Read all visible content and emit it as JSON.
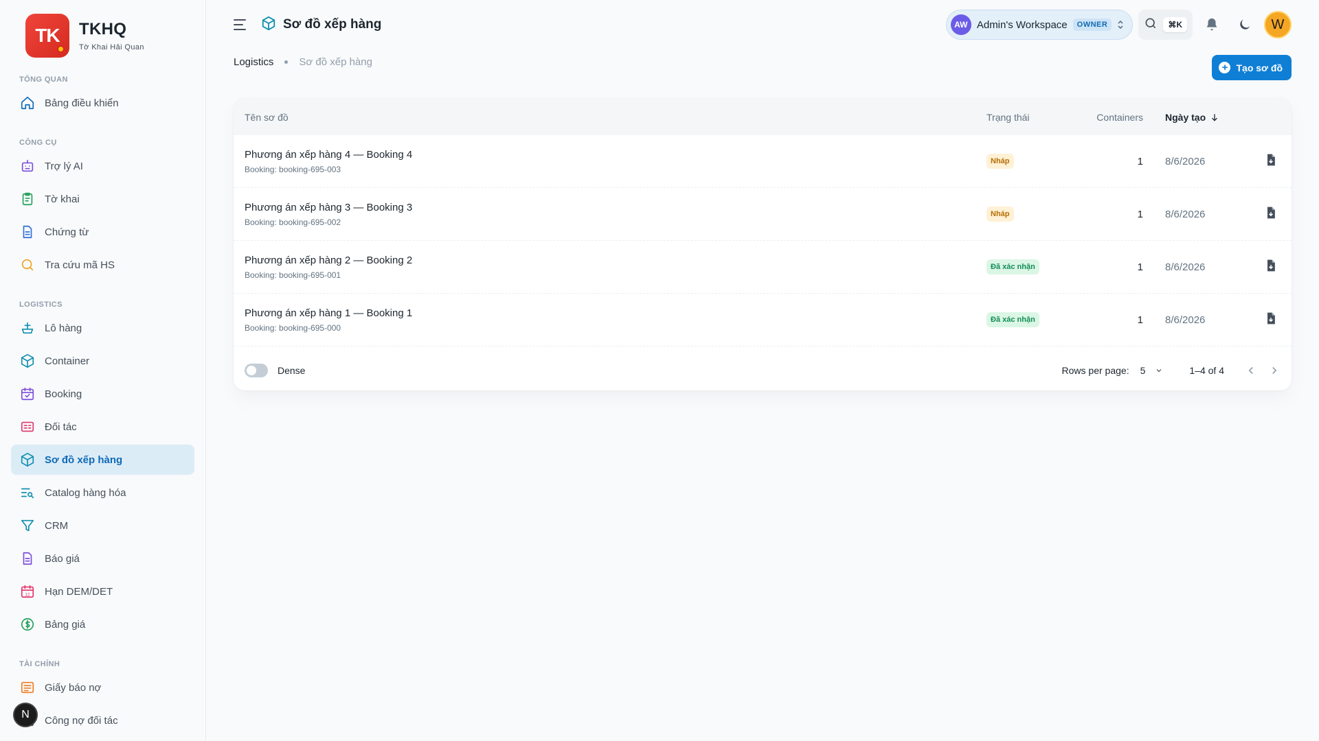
{
  "brand": {
    "logo": "TK",
    "name": "TKHQ",
    "subtitle": "Tờ Khai Hải Quan"
  },
  "sidebar": {
    "sections": [
      {
        "title": "TỔNG QUAN",
        "items": [
          {
            "label": "Bảng điều khiển",
            "icon": "home-icon"
          }
        ]
      },
      {
        "title": "CÔNG CỤ",
        "items": [
          {
            "label": "Trợ lý AI",
            "icon": "robot-icon"
          },
          {
            "label": "Tờ khai",
            "icon": "clipboard-icon"
          },
          {
            "label": "Chứng từ",
            "icon": "document-icon"
          },
          {
            "label": "Tra cứu mã HS",
            "icon": "search-icon"
          }
        ]
      },
      {
        "title": "LOGISTICS",
        "items": [
          {
            "label": "Lô hàng",
            "icon": "ship-icon"
          },
          {
            "label": "Container",
            "icon": "box-icon"
          },
          {
            "label": "Booking",
            "icon": "calendar-check-icon"
          },
          {
            "label": "Đối tác",
            "icon": "id-card-icon"
          },
          {
            "label": "Sơ đồ xếp hàng",
            "icon": "cube-icon",
            "active": true
          },
          {
            "label": "Catalog hàng hóa",
            "icon": "list-search-icon"
          },
          {
            "label": "CRM",
            "icon": "filter-icon"
          },
          {
            "label": "Báo giá",
            "icon": "file-text-icon"
          },
          {
            "label": "Hạn DEM/DET",
            "icon": "calendar-12-icon"
          },
          {
            "label": "Bảng giá",
            "icon": "dollar-circle-icon"
          }
        ]
      },
      {
        "title": "TÀI CHÍNH",
        "items": [
          {
            "label": "Giấy báo nợ",
            "icon": "message-lines-icon"
          },
          {
            "label": "Công nợ đối tác",
            "icon": "wallet-icon"
          }
        ]
      }
    ],
    "floating_badge": "N"
  },
  "header": {
    "title": "Sơ đồ xếp hàng",
    "workspace": {
      "initials": "AW",
      "name": "Admin's Workspace",
      "role": "OWNER"
    },
    "shortcut": "⌘K",
    "user_initial": "W"
  },
  "breadcrumb": {
    "parent": "Logistics",
    "current": "Sơ đồ xếp hàng"
  },
  "create_button": "Tạo sơ đồ",
  "table": {
    "columns": {
      "name": "Tên sơ đồ",
      "status": "Trạng thái",
      "containers": "Containers",
      "created": "Ngày tạo"
    },
    "rows": [
      {
        "name": "Phương án xếp hàng 4 — Booking 4",
        "booking": "Booking: booking-695-003",
        "status": "Nháp",
        "status_type": "draft",
        "containers": "1",
        "created": "8/6/2026"
      },
      {
        "name": "Phương án xếp hàng 3 — Booking 3",
        "booking": "Booking: booking-695-002",
        "status": "Nháp",
        "status_type": "draft",
        "containers": "1",
        "created": "8/6/2026"
      },
      {
        "name": "Phương án xếp hàng 2 — Booking 2",
        "booking": "Booking: booking-695-001",
        "status": "Đã xác nhận",
        "status_type": "ok",
        "containers": "1",
        "created": "8/6/2026"
      },
      {
        "name": "Phương án xếp hàng 1 — Booking 1",
        "booking": "Booking: booking-695-000",
        "status": "Đã xác nhận",
        "status_type": "ok",
        "containers": "1",
        "created": "8/6/2026"
      }
    ],
    "footer": {
      "dense_label": "Dense",
      "rows_per_page_label": "Rows per page:",
      "rows_per_page": "5",
      "range": "1–4 of 4"
    }
  }
}
